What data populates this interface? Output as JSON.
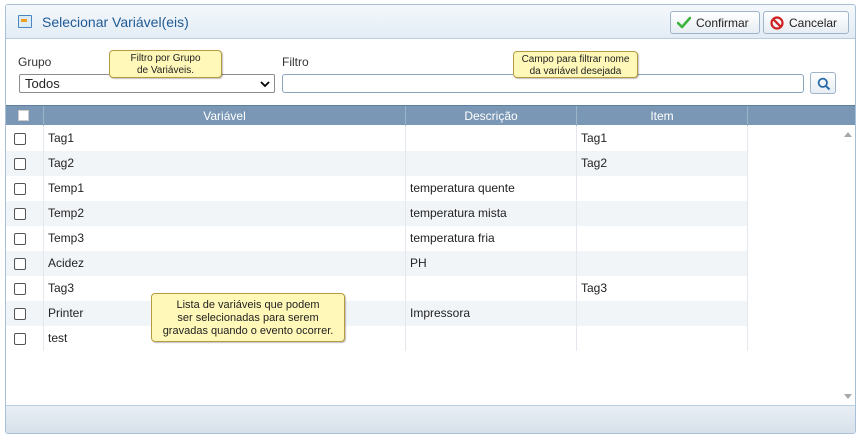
{
  "window": {
    "title": "Selecionar Variável(eis)",
    "confirm_label": "Confirmar",
    "cancel_label": "Cancelar"
  },
  "filters": {
    "group_label": "Grupo",
    "group_selected": "Todos",
    "filter_label": "Filtro",
    "filter_value": ""
  },
  "callouts": {
    "group_tip": "Filtro por Grupo\nde Variáveis.",
    "filter_tip": "Campo para filtrar nome\nda variável desejada",
    "list_tip": "Lista de variáveis que podem\nser selecionadas para serem\ngravadas quando o evento ocorrer."
  },
  "table": {
    "columns": [
      "Variável",
      "Descrição",
      "Item"
    ],
    "rows": [
      {
        "variavel": "Tag1",
        "descricao": "",
        "item": "Tag1"
      },
      {
        "variavel": "Tag2",
        "descricao": "",
        "item": "Tag2"
      },
      {
        "variavel": "Temp1",
        "descricao": "temperatura quente",
        "item": ""
      },
      {
        "variavel": "Temp2",
        "descricao": "temperatura mista",
        "item": ""
      },
      {
        "variavel": "Temp3",
        "descricao": "temperatura fria",
        "item": ""
      },
      {
        "variavel": "Acidez",
        "descricao": "PH",
        "item": ""
      },
      {
        "variavel": "Tag3",
        "descricao": "",
        "item": "Tag3"
      },
      {
        "variavel": "Printer",
        "descricao": "Impressora",
        "item": ""
      },
      {
        "variavel": "test",
        "descricao": "",
        "item": ""
      }
    ]
  },
  "colors": {
    "title_text": "#1f5a94",
    "header_bg": "#7a98b6",
    "callout_bg": "#fff8b8",
    "confirm_icon": "#3cb43c",
    "cancel_icon": "#d02020"
  },
  "icons": {
    "window": "variable-window-icon",
    "confirm": "check-icon",
    "cancel": "cancel-icon",
    "search": "search-icon",
    "dropdown": "chevron-down-icon"
  }
}
